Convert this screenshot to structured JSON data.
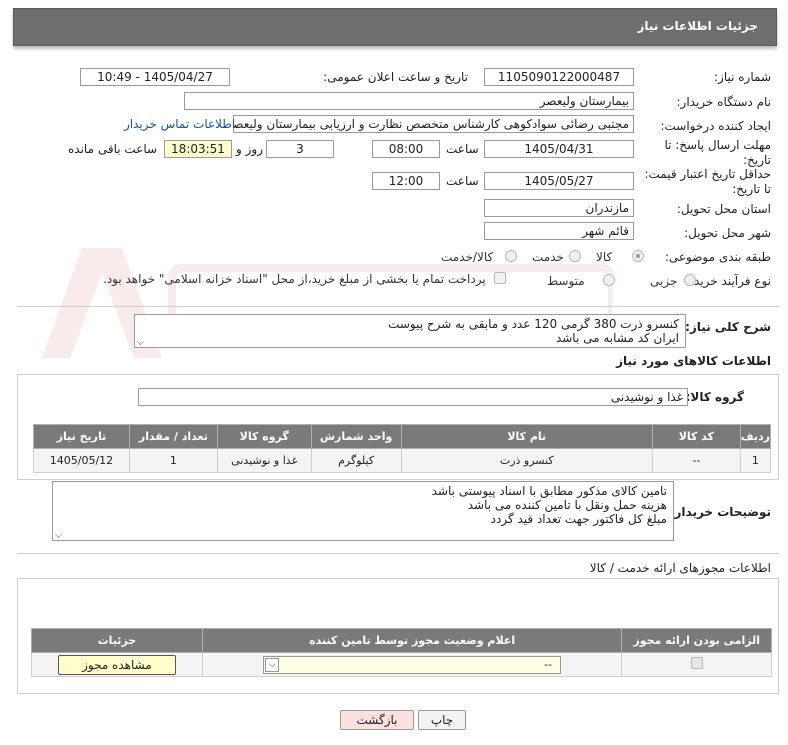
{
  "header": {
    "title": "جزئیات اطلاعات نیاز"
  },
  "form": {
    "need_number_label": "شماره نیاز:",
    "need_number": "1105090122000487",
    "announce_label": "تاریخ و ساعت اعلان عمومی:",
    "announce_value": "1405/04/27 - 10:49",
    "buyer_org_label": "نام دستگاه خریدار:",
    "buyer_org": "بیمارستان ولیعصر",
    "creator_label": "ایجاد کننده درخواست:",
    "creator": "مجتبی رضائی سوادکوهی کارشناس متخصص نظارت و ارزیابی بیمارستان ولیعصر",
    "contact_link": "اطلاعات تماس خریدار",
    "deadline_label": "مهلت ارسال پاسخ: تا تاریخ:",
    "deadline_date": "1405/04/31",
    "time_word": "ساعت",
    "deadline_time": "08:00",
    "days": "3",
    "days_word": "روز و",
    "remaining_time": "18:03:51",
    "remaining_word": "ساعت باقی مانده",
    "price_valid_label": "حداقل تاریخ اعتبار قیمت: تا تاریخ:",
    "price_valid_date": "1405/05/27",
    "price_valid_time": "12:00",
    "province_label": "استان محل تحویل:",
    "province": "مازندران",
    "city_label": "شهر محل تحویل:",
    "city": "قائم شهر",
    "category_label": "طبقه بندی موضوعی:",
    "category_options": [
      "کالا",
      "خدمت",
      "کالا/خدمت"
    ],
    "process_label": "نوع فرآیند خرید :",
    "process_options": [
      "جزیی",
      "متوسط"
    ],
    "treasury_note": "پرداخت تمام یا بخشی از مبلغ خرید،از محل \"اسناد خزانه اسلامی\" خواهد بود."
  },
  "description": {
    "label": "شرح کلی نیاز:",
    "text": "کنسرو ذرت 380 گرمی 120 عدد و مابقی به شرح پیوست\nایران کد مشابه می باشد"
  },
  "goods": {
    "section_title": "اطلاعات کالاهای مورد نیاز",
    "group_label": "گروه کالا:",
    "group_value": "غذا و نوشیدنی",
    "columns": [
      "ردیف",
      "کد کالا",
      "نام کالا",
      "واحد شمارش",
      "گروه کالا",
      "تعداد / مقدار",
      "تاریخ نیاز"
    ],
    "rows": [
      [
        "1",
        "--",
        "کنسرو ذرت",
        "کیلوگرم",
        "غذا و نوشیدنی",
        "1",
        "1405/05/12"
      ]
    ]
  },
  "buyer_notes": {
    "label": "توضیحات خریدار:",
    "text": "تامین کالای  مذکور مطابق با اسناد پیوستی باشد\nهزینه حمل ونقل با تامین کننده می باشد\nمبلغ کل  فاکتور جهت تعداد قید گردد"
  },
  "permits": {
    "section_title": "اطلاعات مجوزهای ارائه خدمت / کالا",
    "columns": [
      "الزامی بودن ارائه مجوز",
      "اعلام وضعیت مجوز توسط تامین کننده",
      "جزئیات"
    ],
    "select_value": "--",
    "view_button": "مشاهده مجوز"
  },
  "footer": {
    "print_button": "چاپ",
    "back_button": "بازگشت"
  },
  "colors": {
    "header_bg": "#6e6e6e",
    "table_header_bg": "#7a7a7a",
    "link": "#1a4fa0",
    "highlight": "#ffffcc",
    "back_button_bg": "#fde0e0"
  }
}
